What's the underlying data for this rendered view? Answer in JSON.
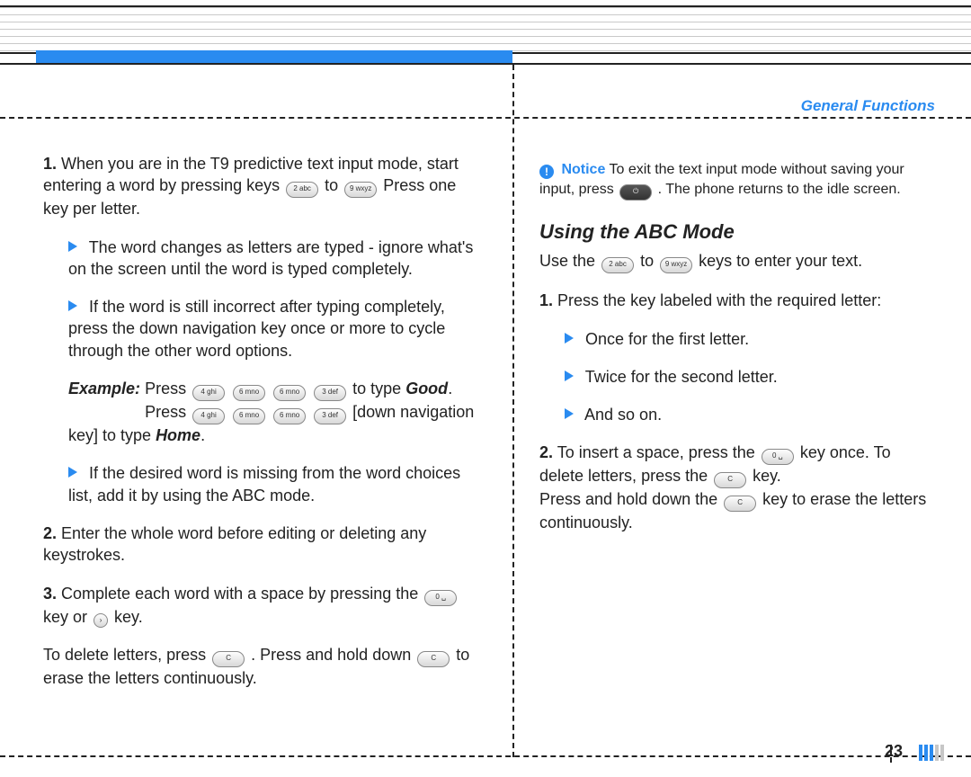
{
  "header": {
    "section": "General Functions"
  },
  "keys": {
    "k2": "2 abc",
    "k3": "3 def",
    "k4": "4 ghi",
    "k6": "6 mno",
    "k9": "9 wxyz",
    "k0": "0 ␣",
    "c": "C",
    "nav": "›",
    "end": "⏻"
  },
  "left": {
    "s1": {
      "num": "1.",
      "a": " When you are in the T9 predictive text input mode, start entering a word by pressing keys ",
      "to": " to ",
      "b": " Press one key per letter."
    },
    "b1": "The word changes as letters are typed - ignore what's on the screen until the word is typed completely.",
    "b2": "If the word is still incorrect after typing completely, press the down navigation key once or more to cycle through the other word options.",
    "ex": {
      "label": "Example:",
      "press": " Press ",
      "a2": " to type ",
      "good": "Good",
      "b1": " [down navigation key] to type ",
      "home": "Home",
      "dot": "."
    },
    "b3": "If the desired word is missing from the word choices list, add it by using the ABC mode.",
    "s2": {
      "num": "2.",
      "t": " Enter the whole word before editing or deleting any keystrokes."
    },
    "s3": {
      "num": "3.",
      "a": " Complete each word with a space by pressing the ",
      "b": " key or ",
      "c": " key."
    },
    "del": {
      "a": "To delete letters, press ",
      "b": " . Press and hold down ",
      "c": " to erase the letters continuously."
    }
  },
  "right": {
    "notice": {
      "label": "Notice",
      "a": " To exit the text input mode without saving your input, press ",
      "b": " . The phone returns to the idle screen."
    },
    "h2": "Using the ABC Mode",
    "intro": {
      "a": "Use the ",
      "to": " to ",
      "b": " keys to enter your text."
    },
    "s1": {
      "num": "1.",
      "t": " Press the key labeled with the required letter:"
    },
    "rb1": "Once for the first letter.",
    "rb2": "Twice for the second letter.",
    "rb3": "And so on.",
    "s2": {
      "num": "2.",
      "a": " To insert a space, press the ",
      "b": " key once. To delete letters, press the ",
      "c": " key.",
      "d": "Press and hold down the ",
      "e": " key to erase the letters continuously."
    }
  },
  "footer": {
    "page": "23"
  }
}
